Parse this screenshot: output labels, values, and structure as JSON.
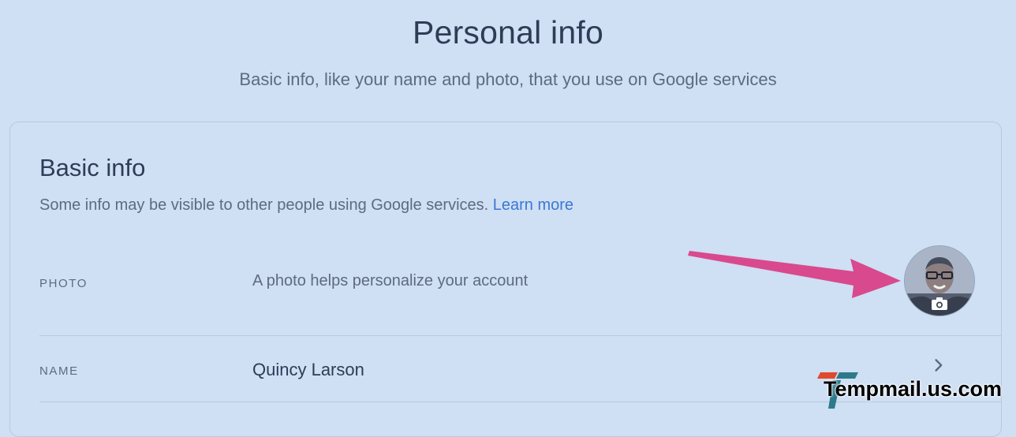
{
  "header": {
    "title": "Personal info",
    "subtitle": "Basic info, like your name and photo, that you use on Google services"
  },
  "basic_info": {
    "title": "Basic info",
    "description": "Some info may be visible to other people using Google services.",
    "learn_more": "Learn more",
    "rows": {
      "photo": {
        "label": "PHOTO",
        "value": "A photo helps personalize your account",
        "icon": "avatar-photo"
      },
      "name": {
        "label": "NAME",
        "value": "Quincy Larson",
        "icon": "chevron-right-icon"
      }
    }
  },
  "annotation": {
    "icon": "pink-arrow",
    "color": "#d9498e"
  },
  "watermark": {
    "text": "Tempmail.us.com"
  },
  "colors": {
    "background": "#cfdff4",
    "link": "#3a78d4",
    "title": "#2e3c55",
    "muted": "#5d6b7e"
  }
}
